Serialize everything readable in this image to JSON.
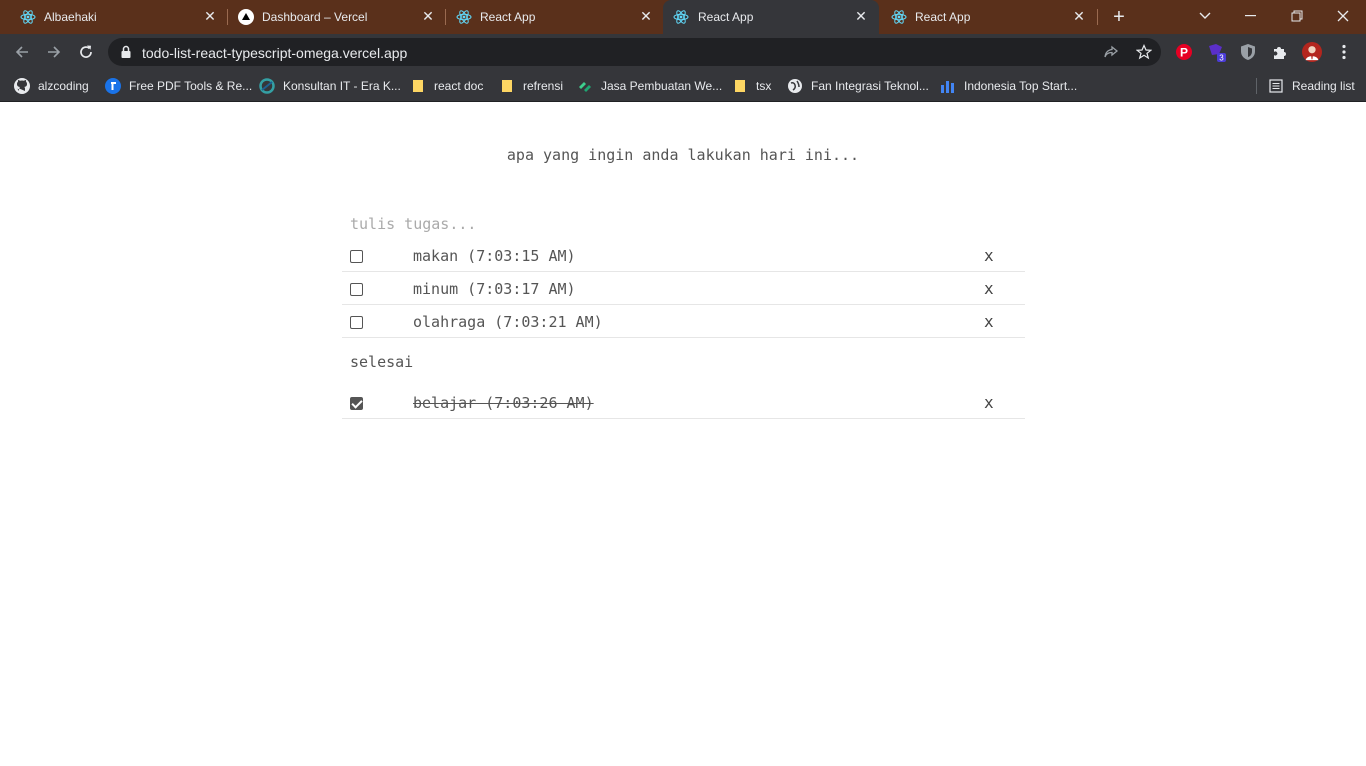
{
  "browser": {
    "tabs": [
      {
        "title": "Albaehaki",
        "icon": "react-icon"
      },
      {
        "title": "Dashboard – Vercel",
        "icon": "vercel-icon"
      },
      {
        "title": "React App",
        "icon": "react-icon"
      },
      {
        "title": "React App",
        "icon": "react-icon",
        "active": true
      },
      {
        "title": "React App",
        "icon": "react-icon"
      }
    ],
    "url": "todo-list-react-typescript-omega.vercel.app",
    "bookmarks": [
      {
        "label": "alzcoding",
        "icon": "github-icon"
      },
      {
        "label": "Free PDF Tools & Re...",
        "icon": "pdf-tool-icon"
      },
      {
        "label": "Konsultan IT - Era K...",
        "icon": "globe-icon"
      },
      {
        "label": "react doc",
        "icon": "folder-icon"
      },
      {
        "label": "refrensi",
        "icon": "folder-icon"
      },
      {
        "label": "Jasa Pembuatan We...",
        "icon": "site-icon"
      },
      {
        "label": "tsx",
        "icon": "folder-icon"
      },
      {
        "label": "Fan Integrasi Teknol...",
        "icon": "globe-icon"
      },
      {
        "label": "Indonesia Top Start...",
        "icon": "bar-chart-icon"
      }
    ],
    "reading_list": "Reading list",
    "extension_badge": "3",
    "colors": {
      "tabstrip": "#5a301b",
      "toolbar": "#35363a",
      "omnibox": "#202124"
    }
  },
  "app": {
    "heading": "apa yang ingin anda lakukan hari ini...",
    "input_placeholder": "tulis tugas...",
    "todos": [
      {
        "text": "makan (7:03:15 AM)",
        "done": false,
        "delete": "x"
      },
      {
        "text": "minum (7:03:17 AM)",
        "done": false,
        "delete": "x"
      },
      {
        "text": "olahraga (7:03:21 AM)",
        "done": false,
        "delete": "x"
      }
    ],
    "done_label": "selesai",
    "done_todos": [
      {
        "text": "belajar (7:03:26 AM)",
        "done": true,
        "delete": "x"
      }
    ]
  }
}
